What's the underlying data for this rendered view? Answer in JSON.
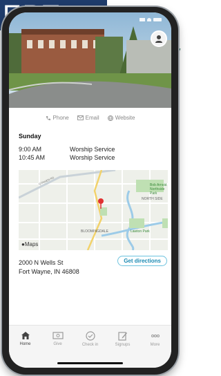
{
  "banner_text": "EPT",
  "contact": {
    "phone": "Phone",
    "email": "Email",
    "website": "Website"
  },
  "schedule": {
    "day": "Sunday",
    "services": [
      {
        "time": "9:00 AM",
        "name": "Worship Service"
      },
      {
        "time": "10:45 AM",
        "name": "Worship Service"
      }
    ]
  },
  "map": {
    "labels": {
      "park1": "Bob Arnold Northside Park",
      "north_side": "NORTH SIDE",
      "bloomingdale": "BLOOMINGDALE",
      "lawton": "Lawton Park",
      "road": "GOSHEN RD",
      "attribution": "Maps"
    }
  },
  "address": {
    "line1": "2000 N Wells St",
    "line2": "Fort Wayne, IN 46808"
  },
  "directions_label": "Get directions",
  "tabs": [
    {
      "label": "Home",
      "icon": "home-icon",
      "active": true
    },
    {
      "label": "Give",
      "icon": "give-icon"
    },
    {
      "label": "Check in",
      "icon": "check-in-icon"
    },
    {
      "label": "Signups",
      "icon": "signups-icon"
    },
    {
      "label": "More",
      "icon": "more-icon"
    }
  ],
  "colors": {
    "banner": "#1f3c6b",
    "accent": "#1b8ab3",
    "swirl": "#2f6f5e",
    "map_pin": "#e03131"
  }
}
